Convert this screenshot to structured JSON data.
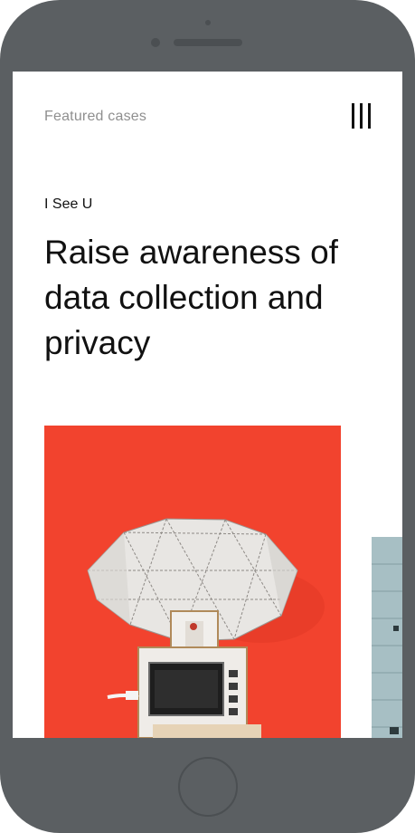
{
  "header": {
    "title": "Featured cases",
    "menu_icon": "menu-icon"
  },
  "featured_case": {
    "kicker": "I See U",
    "headline": "Raise awareness of data collection and privacy",
    "image_icon": "satellite-dish-device-photo",
    "image_background": "#f2432e"
  },
  "next_case": {
    "image_icon": "building-photo",
    "image_background": "#a7bfc4"
  },
  "device": {
    "frame_color": "#5b5f62"
  }
}
